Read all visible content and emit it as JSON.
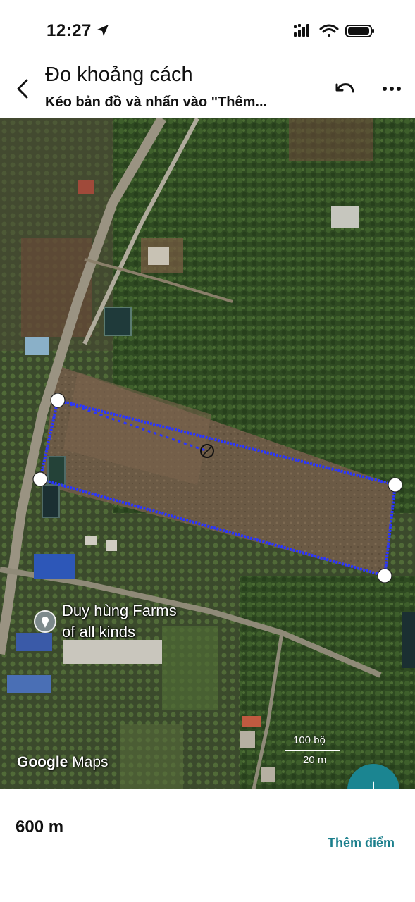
{
  "status_bar": {
    "time": "12:27",
    "icons": [
      "location-arrow-icon",
      "signal-icon",
      "wifi-icon",
      "battery-icon"
    ]
  },
  "header": {
    "title": "Đo khoảng cách",
    "subtitle": "Kéo bản đồ và nhấn vào \"Thêm...",
    "icons": [
      "back-icon",
      "undo-icon",
      "more-icon"
    ]
  },
  "map": {
    "place_name_line1": "Duy hùng Farms",
    "place_name_line2": "of all kinds",
    "attribution_google": "Google",
    "attribution_maps": "Maps",
    "scale_feet": "100 bộ",
    "scale_meters": "20 m",
    "measure_color": "#2a35ff"
  },
  "bottom": {
    "distance": "600 m",
    "add_point_label": "Thêm điểm"
  },
  "colors": {
    "accent": "#1b8591"
  }
}
